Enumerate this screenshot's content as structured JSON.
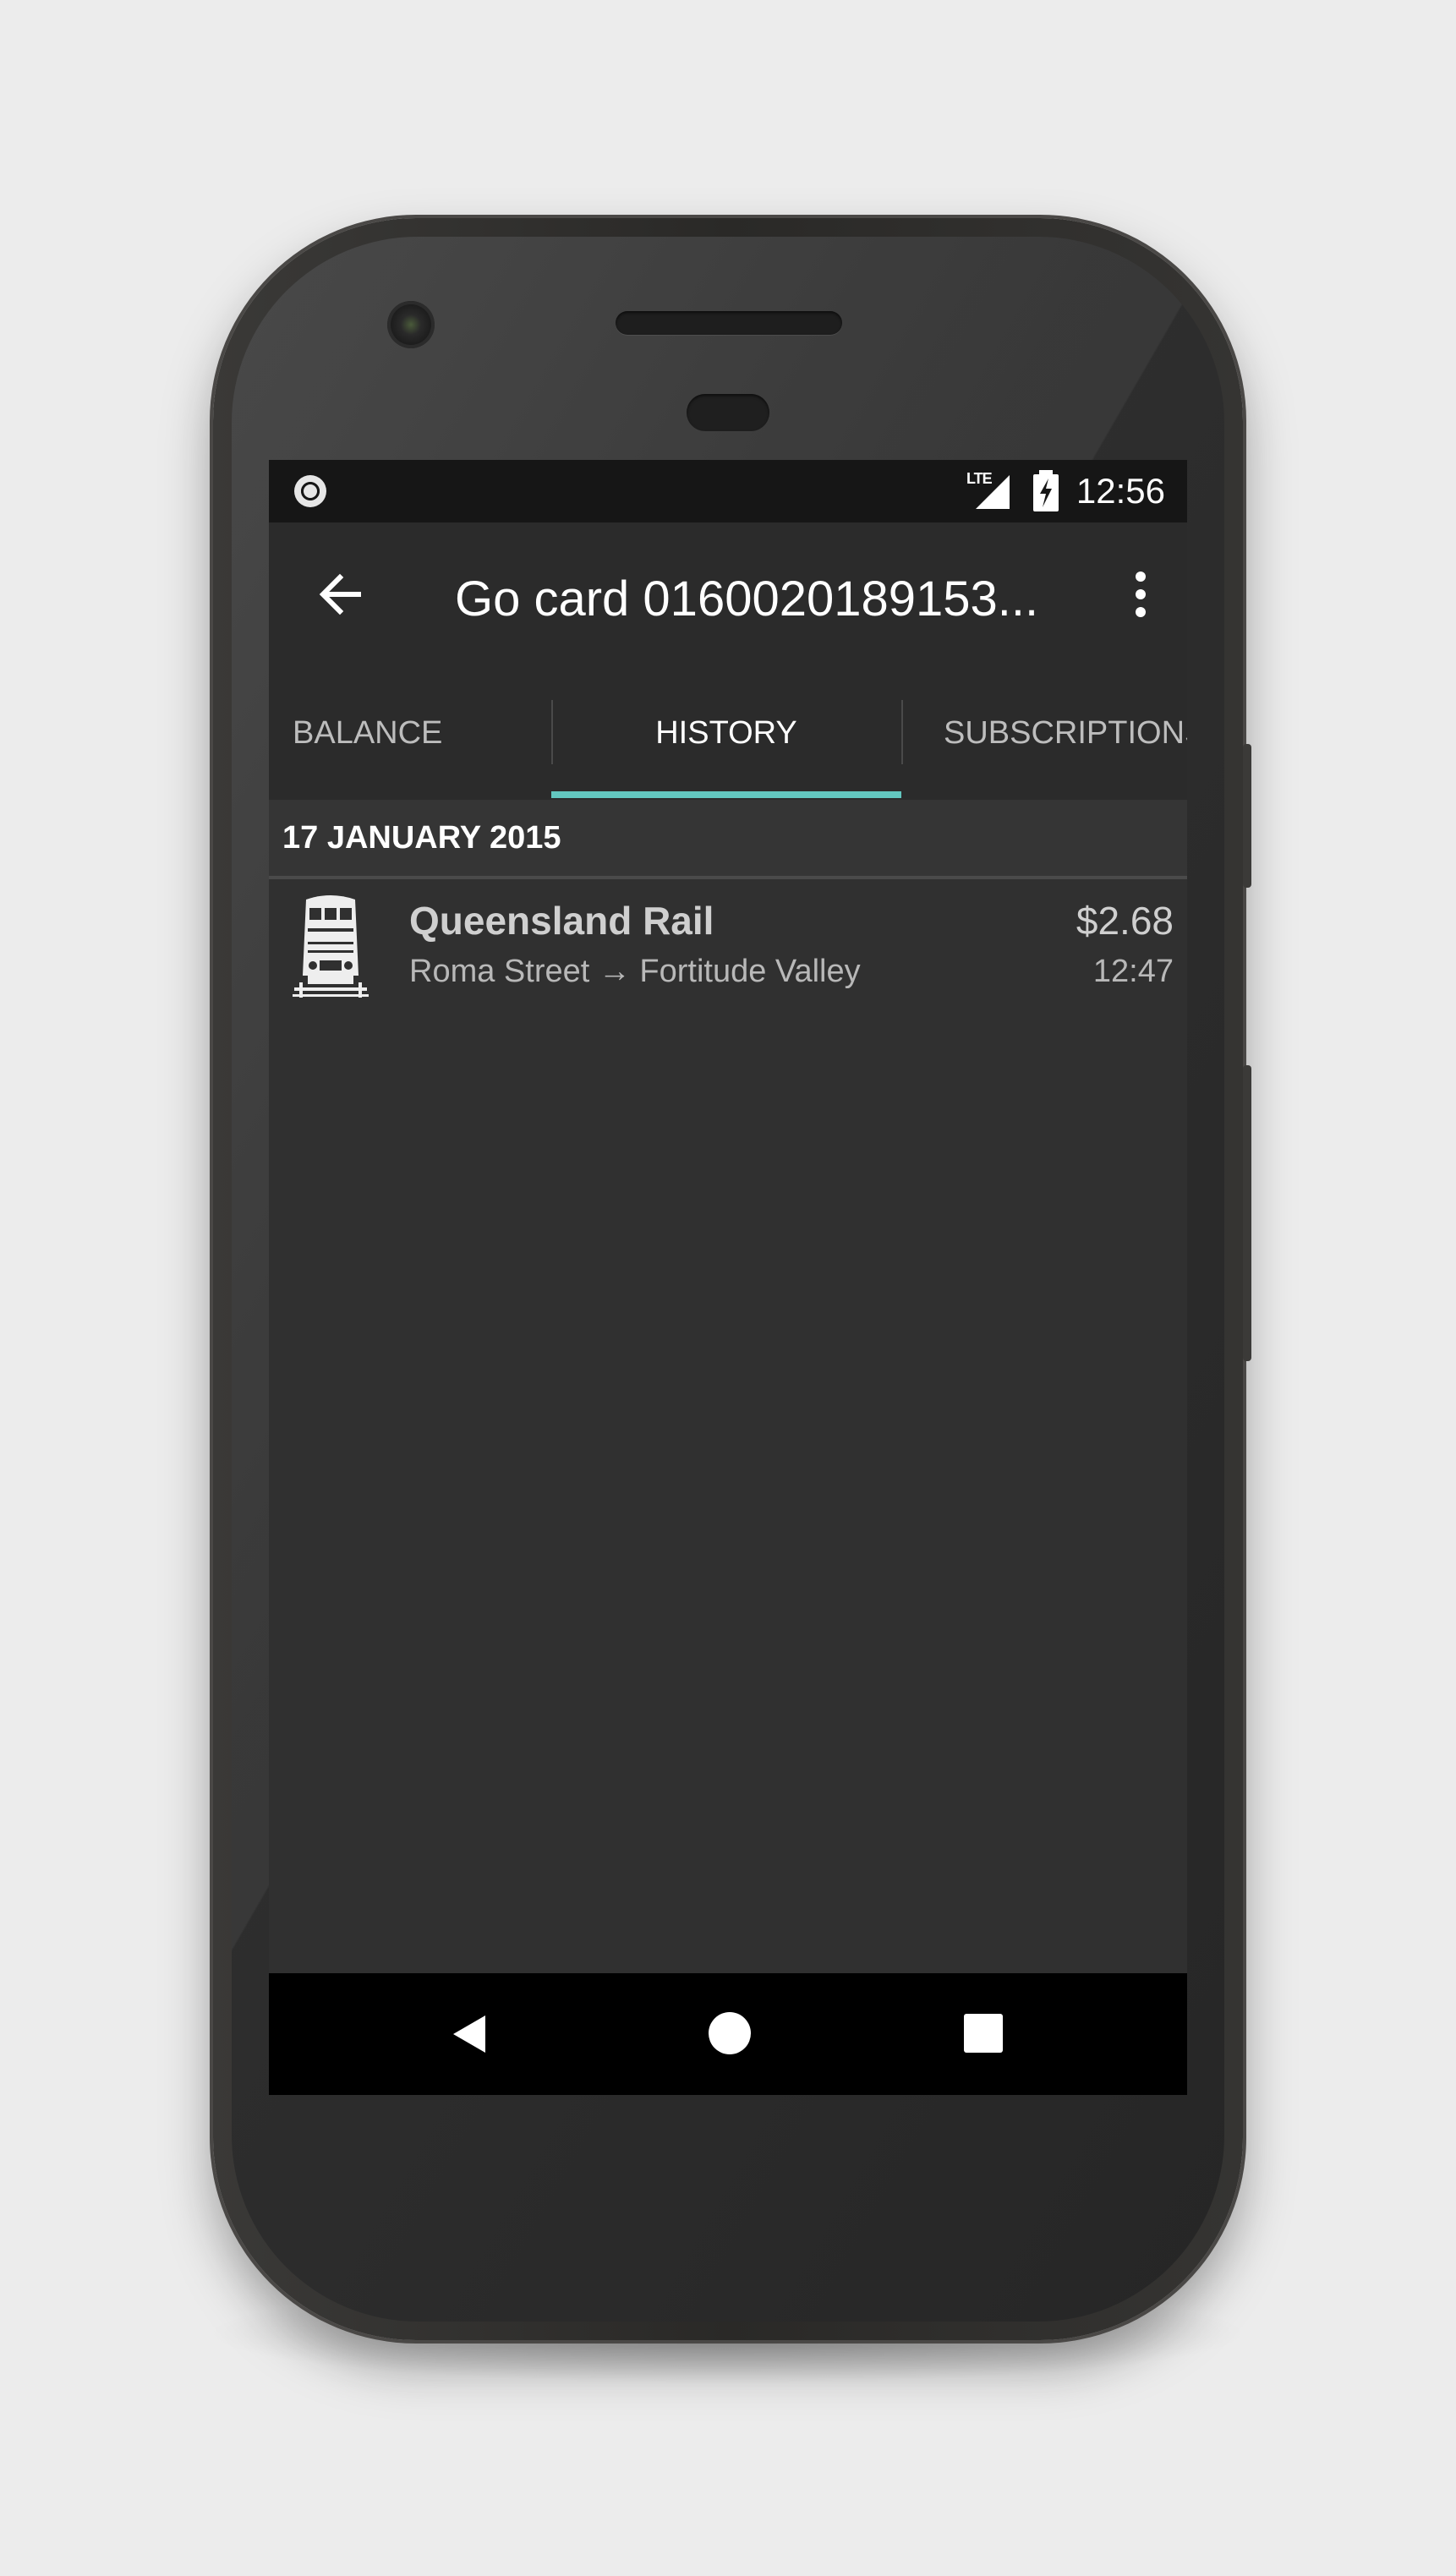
{
  "status_bar": {
    "network": "LTE",
    "time": "12:56"
  },
  "toolbar": {
    "title": "Go card 0160020189153...",
    "back_icon": "arrow-left-icon",
    "menu_icon": "more-vert-icon"
  },
  "tabs": [
    {
      "label": "BALANCE",
      "active": false
    },
    {
      "label": "HISTORY",
      "active": true
    },
    {
      "label": "SUBSCRIPTIONS",
      "active": false
    }
  ],
  "history": {
    "date_header": "17 JANUARY 2015",
    "trips": [
      {
        "icon": "train-icon",
        "operator": "Queensland Rail",
        "route": "Roma Street → Fortitude Valley",
        "fare": "$2.68",
        "time": "12:47"
      }
    ]
  },
  "colors": {
    "accent": "#63c7bf",
    "background": "#303030",
    "toolbar": "#2b2b2b",
    "status_bar": "#161616",
    "nav_bar": "#000000"
  }
}
